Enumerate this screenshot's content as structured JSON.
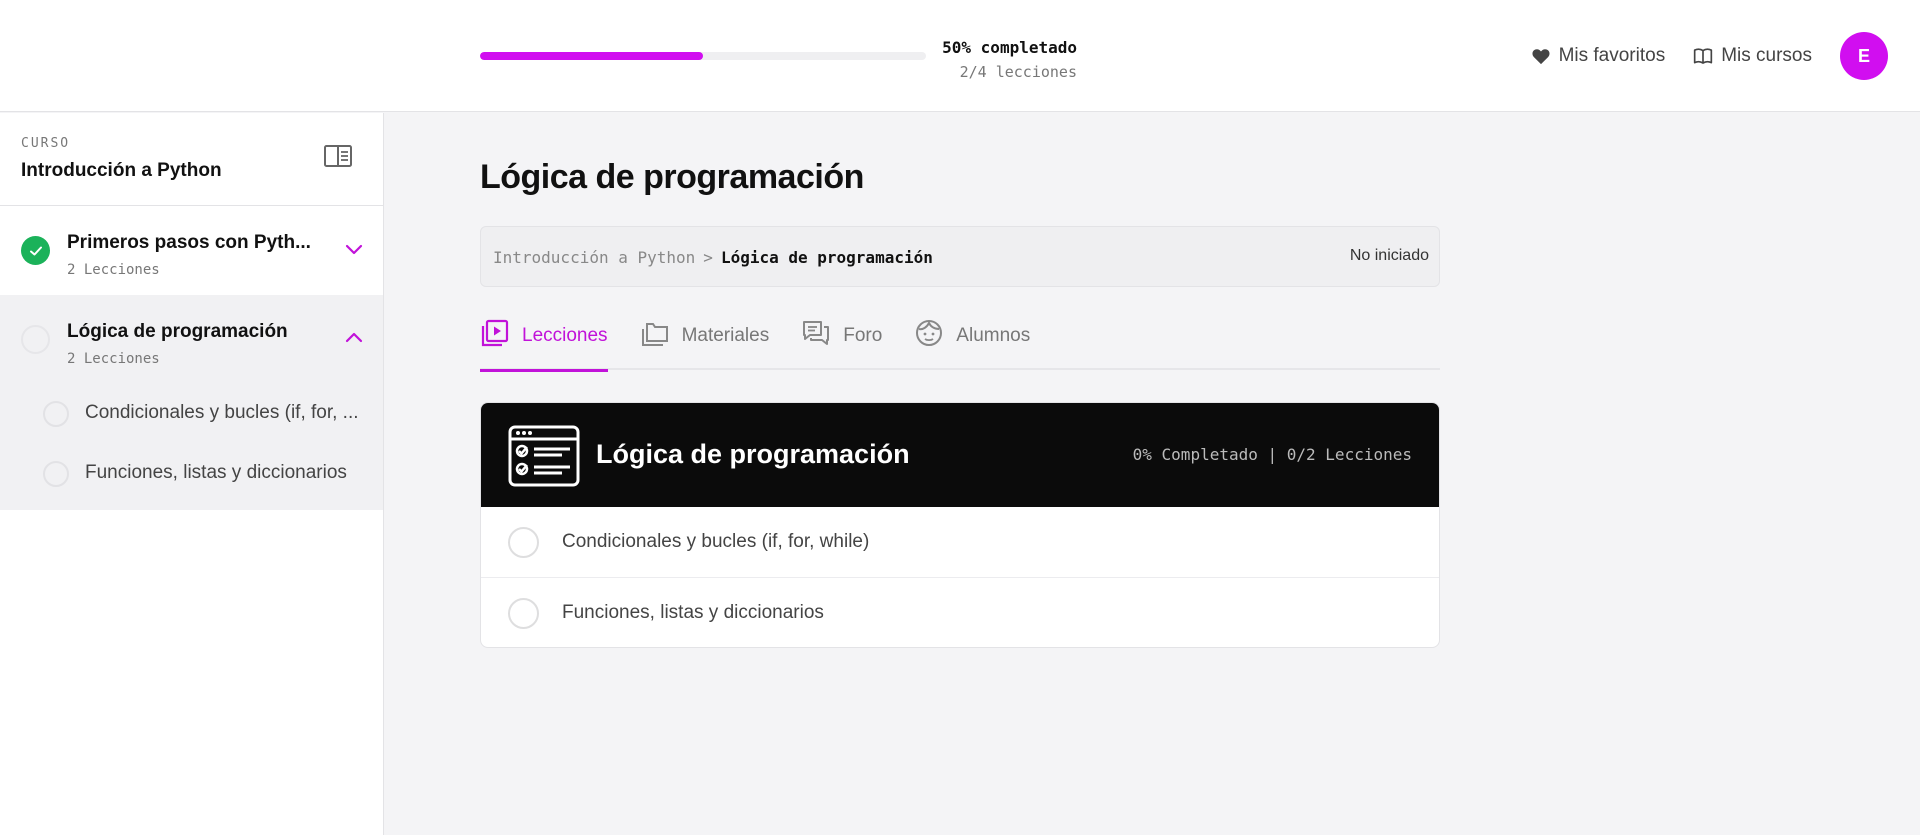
{
  "header": {
    "progress": {
      "fraction": 0.5,
      "percent_label": "50% completado",
      "count_label": "2/4 lecciones"
    },
    "favorites_label": "Mis favoritos",
    "courses_label": "Mis cursos",
    "avatar_initial": "E"
  },
  "sidebar": {
    "kicker": "CURSO",
    "course_title": "Introducción a Python",
    "modules": [
      {
        "title": "Primeros pasos con Pyth...",
        "subtitle": "2 Lecciones",
        "status": "completed",
        "expanded": false
      },
      {
        "title": "Lógica de programación",
        "subtitle": "2 Lecciones",
        "status": "not-started",
        "expanded": true,
        "lessons": [
          {
            "label": "Condicionales y bucles (if, for, ..."
          },
          {
            "label": "Funciones, listas y diccionarios"
          }
        ]
      }
    ]
  },
  "main": {
    "title": "Lógica de programación",
    "breadcrumb": {
      "root": "Introducción a Python",
      "separator": ">",
      "current": "Lógica de programación",
      "status": "No iniciado"
    },
    "tabs": [
      {
        "label": "Lecciones",
        "active": true
      },
      {
        "label": "Materiales",
        "active": false
      },
      {
        "label": "Foro",
        "active": false
      },
      {
        "label": "Alumnos",
        "active": false
      }
    ],
    "card": {
      "title": "Lógica de programación",
      "meta": "0% Completado | 0/2 Lecciones",
      "lessons": [
        {
          "label": "Condicionales y bucles (if, for, while)"
        },
        {
          "label": "Funciones, listas y diccionarios"
        }
      ]
    }
  },
  "colors": {
    "accent": "#d10ef0",
    "tab_active": "#c112d9",
    "success": "#1bb25a",
    "card_header": "#0b0b0b"
  }
}
